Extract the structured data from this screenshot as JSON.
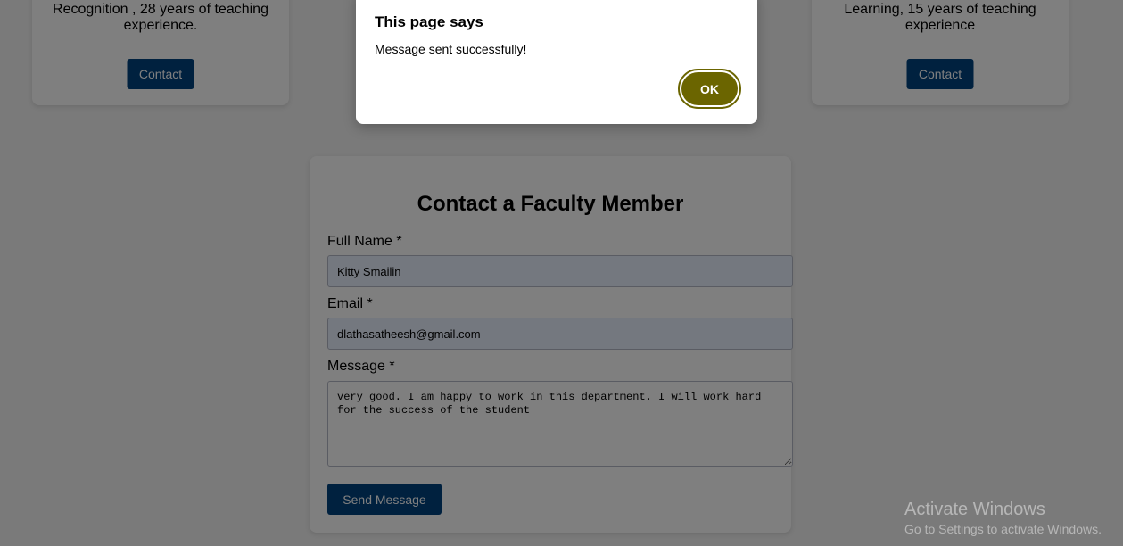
{
  "cards": [
    {
      "description": "Recognition , 28 years of teaching\nexperience.",
      "contact_label": "Contact"
    },
    {
      "description": "Learning, 15 years of teaching\nexperience",
      "contact_label": "Contact"
    }
  ],
  "form": {
    "title": "Contact a Faculty Member",
    "name_label": "Full Name *",
    "name_value": "Kitty Smailin",
    "email_label": "Email *",
    "email_value": "dlathasatheesh@gmail.com",
    "message_label": "Message *",
    "message_value": "very good. I am happy to work in this department. I will work hard for the success of the student",
    "send_label": "Send Message"
  },
  "dialog": {
    "title": "This page says",
    "message": "Message sent successfully!",
    "ok_label": "OK"
  },
  "watermark": {
    "title": "Activate Windows",
    "subtitle": "Go to Settings to activate Windows."
  },
  "colors": {
    "button_blue": "#00427f",
    "ok_olive": "#6b6500",
    "autofill_bg": "#e8f0fe"
  }
}
